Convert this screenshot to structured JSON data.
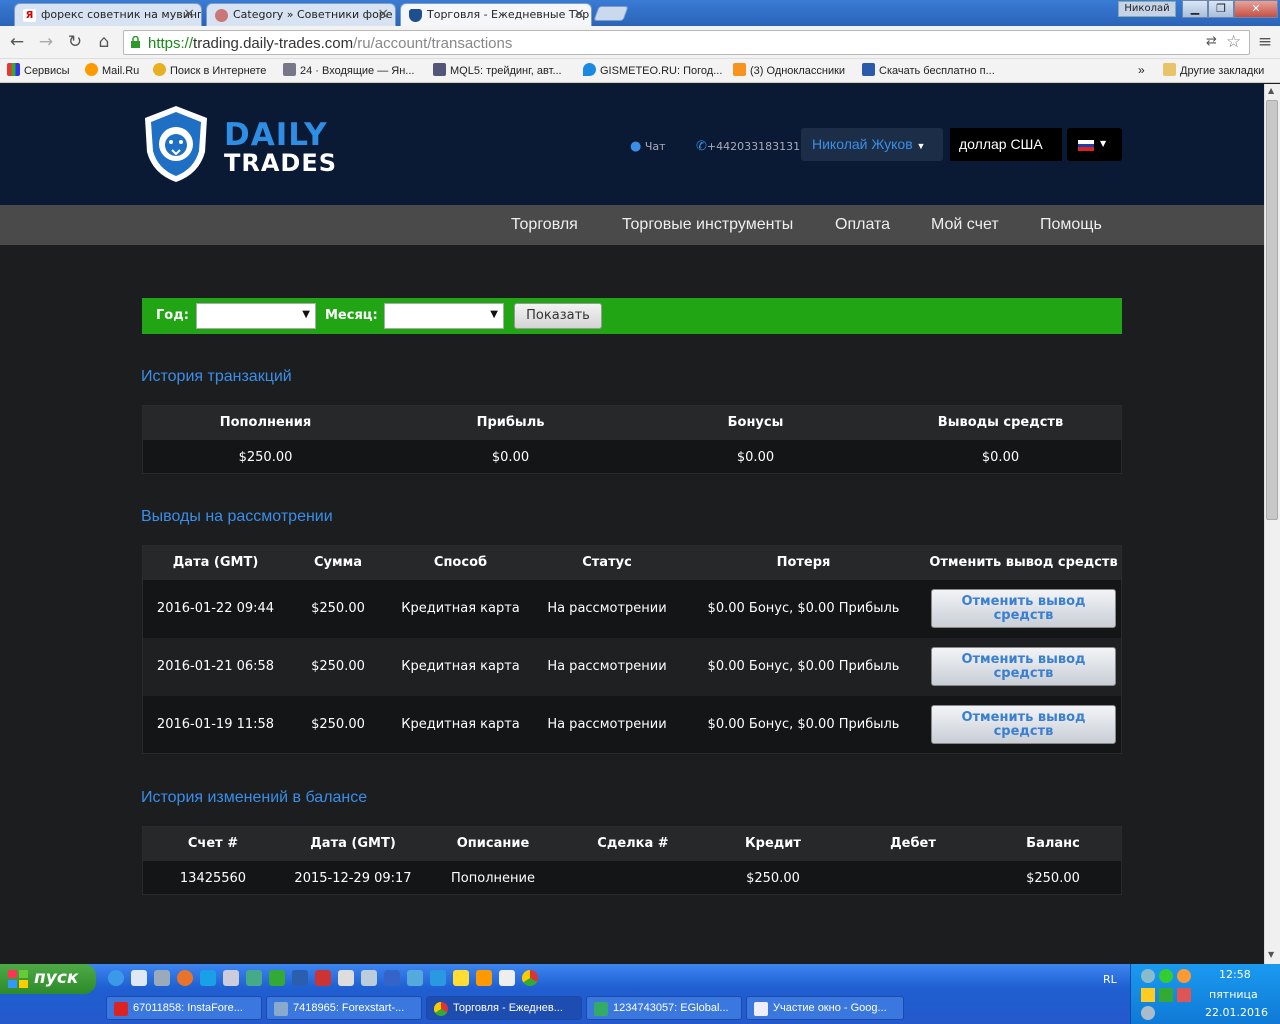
{
  "browser": {
    "tabs": [
      {
        "label": "форекс советник на мувинг",
        "icon": "yandex-icon",
        "active": false
      },
      {
        "label": "Category » Советники форе",
        "icon": "butterfly-icon",
        "active": false
      },
      {
        "label": "Торговля - Ежедневные Тор",
        "icon": "shield-icon",
        "active": true
      }
    ],
    "user_chip": "Николай",
    "url": {
      "scheme": "https://",
      "host": "trading.daily-trades.com",
      "path": "/ru/account/transactions"
    },
    "bookmarks": [
      {
        "label": "Сервисы",
        "icon": "apps-icon"
      },
      {
        "label": "Mail.Ru",
        "icon": "mailru-icon"
      },
      {
        "label": "Поиск в Интернете",
        "icon": "search-icon"
      },
      {
        "label": "24 · Входящие — Ян...",
        "icon": "mail-icon"
      },
      {
        "label": "MQL5: трейдинг, авт...",
        "icon": "mql5-icon"
      },
      {
        "label": "GISMETEO.RU: Погод...",
        "icon": "drop-icon"
      },
      {
        "label": "(3) Одноклассники",
        "icon": "ok-icon"
      },
      {
        "label": "Скачать бесплатно п...",
        "icon": "download-icon"
      }
    ],
    "bookmarks_more": "»",
    "other_bookmarks": "Другие закладки"
  },
  "site": {
    "logo_top": "DAILY",
    "logo_bottom": "TRADES",
    "chat": "Чат",
    "phone": "+442033183131",
    "user_name": "Николай Жуков",
    "currency": "доллар США",
    "nav": [
      "Торговля",
      "Торговые инструменты",
      "Оплата",
      "Мой счет",
      "Помощь"
    ],
    "filter": {
      "year_label": "Год:",
      "month_label": "Месяц:",
      "show_label": "Показать"
    }
  },
  "transactions": {
    "title": "История транзакций",
    "headers": [
      "Пополнения",
      "Прибыль",
      "Бонусы",
      "Выводы средств"
    ],
    "values": [
      "$250.00",
      "$0.00",
      "$0.00",
      "$0.00"
    ]
  },
  "withdrawals": {
    "title": "Выводы на рассмотрении",
    "headers": [
      "Дата (GMT)",
      "Сумма",
      "Способ",
      "Статус",
      "Потеря",
      "Отменить вывод средств"
    ],
    "rows": [
      {
        "date": "2016-01-22 09:44",
        "amount": "$250.00",
        "method": "Кредитная карта",
        "status": "На рассмотрении",
        "loss": "$0.00 Бонус, $0.00 Прибыль",
        "cancel": "Отменить вывод средств"
      },
      {
        "date": "2016-01-21 06:58",
        "amount": "$250.00",
        "method": "Кредитная карта",
        "status": "На рассмотрении",
        "loss": "$0.00 Бонус, $0.00 Прибыль",
        "cancel": "Отменить вывод средств"
      },
      {
        "date": "2016-01-19 11:58",
        "amount": "$250.00",
        "method": "Кредитная карта",
        "status": "На рассмотрении",
        "loss": "$0.00 Бонус, $0.00 Прибыль",
        "cancel": "Отменить вывод средств"
      }
    ]
  },
  "balance": {
    "title": "История изменений в балансе",
    "headers": [
      "Счет #",
      "Дата (GMT)",
      "Описание",
      "Сделка #",
      "Кредит",
      "Дебет",
      "Баланс"
    ],
    "rows": [
      {
        "account": "13425560",
        "date": "2015-12-29 09:17",
        "description": "Пополнение",
        "deal": "",
        "credit": "$250.00",
        "debit": "",
        "balance": "$250.00"
      }
    ]
  },
  "taskbar": {
    "start": "пуск",
    "tasks": [
      {
        "label": "67011858: InstaFore...",
        "icon": "insta-icon"
      },
      {
        "label": "7418965: Forexstart-...",
        "icon": "forexstart-icon"
      },
      {
        "label": "Торговля - Ежеднев...",
        "icon": "chrome-icon",
        "active": true
      },
      {
        "label": "1234743057: EGlobal...",
        "icon": "mt4-icon"
      },
      {
        "label": "Участие окно - Goog...",
        "icon": "doc-icon"
      }
    ],
    "lang": "RL",
    "time": "12:58",
    "day": "пятница",
    "date": "22.01.2016"
  }
}
